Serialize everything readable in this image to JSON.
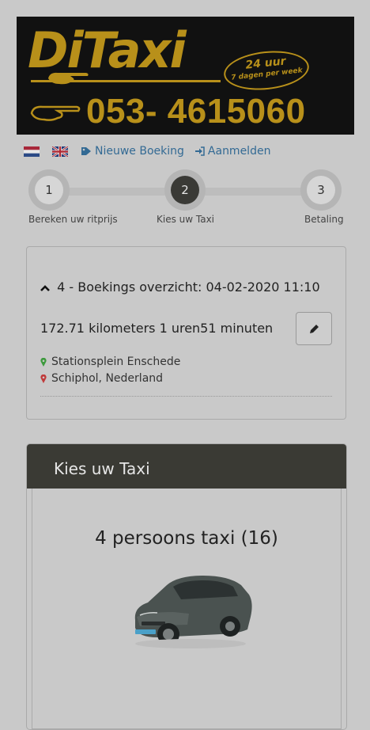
{
  "banner": {
    "logo": "DiTaxi",
    "badge_line1": "24 uur",
    "badge_line2": "7 dagen per week",
    "phone": "053- 4615060"
  },
  "nav": {
    "new_booking": "Nieuwe Boeking",
    "login": "Aanmelden"
  },
  "steps": [
    {
      "number": "1",
      "label": "Bereken uw ritprijs"
    },
    {
      "number": "2",
      "label": "Kies uw Taxi"
    },
    {
      "number": "3",
      "label": "Betaling"
    }
  ],
  "summary": {
    "title": "4 - Boekings overzicht:  04-02-2020 11:10",
    "distance": "172.71 kilometers 1 uren51 minuten",
    "from": "Stationsplein Enschede",
    "to": "Schiphol, Nederland"
  },
  "taxi_panel": {
    "header": "Kies uw Taxi",
    "taxi_name": "4 persoons taxi (16)"
  },
  "colors": {
    "gold": "#b8901a",
    "link": "#336a94",
    "dark_header": "#3a3a34",
    "pin_from": "#3d9a3d",
    "pin_to": "#c03a3a"
  }
}
